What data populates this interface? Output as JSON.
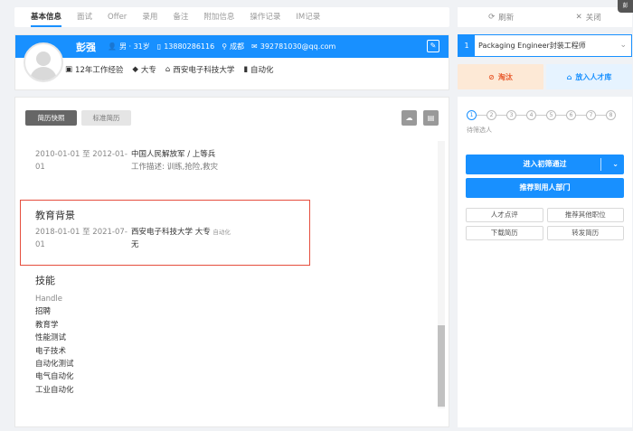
{
  "tabs": [
    "基本信息",
    "面试",
    "Offer",
    "录用",
    "备注",
    "附加信息",
    "操作记录",
    "IM记录"
  ],
  "top_actions": {
    "refresh": "刷新",
    "close": "关闭"
  },
  "profile": {
    "name": "彭强",
    "gender_age": "男 · 31岁",
    "phone": "13880286116",
    "city": "成都",
    "email": "392781030@qq.com",
    "experience": "12年工作经验",
    "degree": "大专",
    "school": "西安电子科技大学",
    "major": "自动化"
  },
  "job": {
    "index": "1",
    "title": "Packaging Engineer封装工程师"
  },
  "actions": {
    "eliminate": "淘汰",
    "talent_pool": "放入人才库"
  },
  "resume_buttons": {
    "snapshot": "简历快照",
    "standard": "标准简历"
  },
  "work": {
    "date": "2010-01-01 至 2012-01-01",
    "company": "中国人民解放军 / 上等兵",
    "desc": "工作描述: 训练,抢险,救灾"
  },
  "education": {
    "title": "教育背景",
    "date": "2018-01-01 至 2021-07-01",
    "school": "西安电子科技大学 大专",
    "major": "自动化",
    "note": "无"
  },
  "skills": {
    "title": "技能",
    "items": [
      "Handle",
      "招聘",
      "教育学",
      "性能测试",
      "电子技术",
      "自动化测试",
      "电气自动化",
      "工业自动化"
    ]
  },
  "pipeline": {
    "steps": [
      "1",
      "2",
      "3",
      "4",
      "5",
      "6",
      "7",
      "8"
    ],
    "current_label": "待筛选人",
    "pass_button": "进入初筛通过",
    "recommend_button": "推荐到用人部门",
    "small_buttons": [
      "人才点评",
      "推荐其他职位",
      "下载简历",
      "转发简历"
    ]
  },
  "corner_badge": "彭"
}
